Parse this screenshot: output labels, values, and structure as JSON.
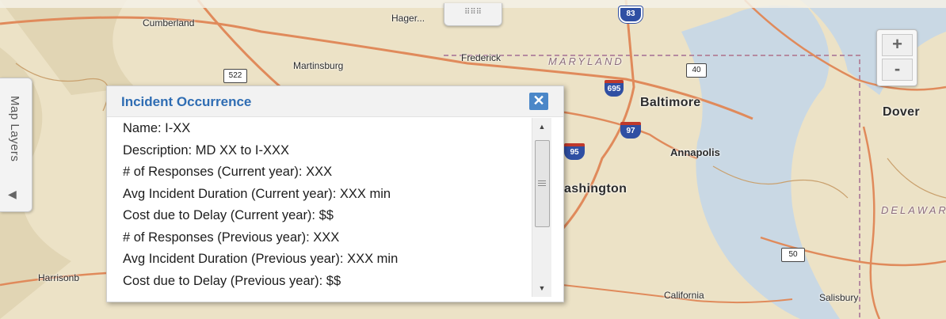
{
  "map": {
    "places": {
      "cumberland": "Cumberland",
      "hagerstown": "Hager...",
      "martinsburg": "Martinsburg",
      "frederick": "Frederick",
      "maryland": "MARYLAND",
      "baltimore": "Baltimore",
      "dover": "Dover",
      "annapolis": "Annapolis",
      "washington": "ashington",
      "delaware": "DELAWAR",
      "harrisonburg": "Harrisonb",
      "california": "California",
      "salisbury": "Salisbury"
    },
    "shields": {
      "us83": "83",
      "us522": "522",
      "us40": "40",
      "i695": "695",
      "i97": "97",
      "i95": "95",
      "us50": "50"
    },
    "colors": {
      "land": "#ece2c6",
      "highway": "#e08a5b",
      "water": "#c9d8e4",
      "interstate": "#2f4fa3"
    }
  },
  "layers_panel": {
    "label": "Map Layers",
    "collapse_glyph": "◀"
  },
  "drag_handle": {
    "glyph": "⠿⠿⠿"
  },
  "zoom": {
    "in_label": "+",
    "out_label": "-"
  },
  "popup": {
    "title": "Incident Occurrence",
    "close_label": "✕",
    "rows": [
      "Name: I-XX",
      "Description: MD XX to I-XXX",
      "# of Responses (Current year): XXX",
      "Avg Incident Duration (Current year): XXX min",
      "Cost due to Delay (Current year): $$",
      "# of Responses (Previous year): XXX",
      "Avg Incident Duration (Previous year): XXX min",
      "Cost due to Delay (Previous year): $$"
    ],
    "scroll_up": "▲",
    "scroll_down": "▼",
    "accent": "#2f6db3"
  }
}
